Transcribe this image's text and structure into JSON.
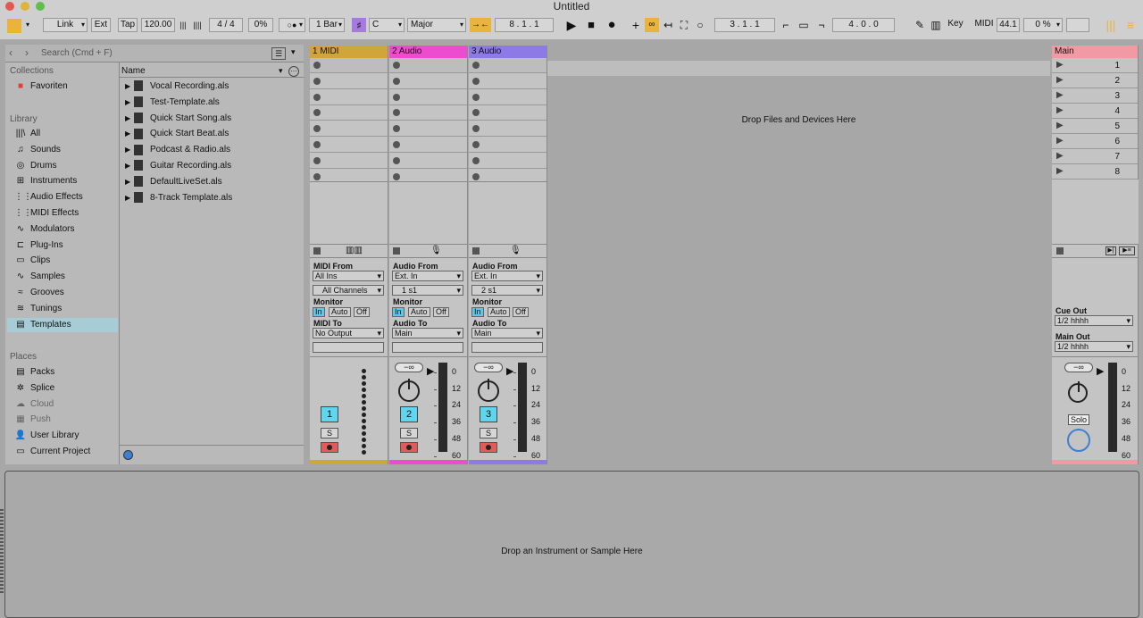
{
  "window": {
    "title": "Untitled"
  },
  "control_bar": {
    "link": "Link",
    "ext": "Ext",
    "tap": "Tap",
    "tempo": "120.00",
    "signature": "4 / 4",
    "cpu": "0%",
    "quantize": "1 Bar",
    "key": "C",
    "scale": "Major",
    "position": "8 . 1 . 1",
    "loop_start": "3 . 1 . 1",
    "loop_length": "4 . 0 . 0",
    "key_label": "Key",
    "midi_label": "MIDI",
    "sample_rate": "44.1",
    "cpu_load": "0 %"
  },
  "browser": {
    "search_placeholder": "Search (Cmd + F)",
    "collections_heading": "Collections",
    "favorites": "Favoriten",
    "library_heading": "Library",
    "library_items": [
      "All",
      "Sounds",
      "Drums",
      "Instruments",
      "Audio Effects",
      "MIDI Effects",
      "Modulators",
      "Plug-Ins",
      "Clips",
      "Samples",
      "Grooves",
      "Tunings",
      "Templates"
    ],
    "places_heading": "Places",
    "places_items": [
      "Packs",
      "Splice",
      "Cloud",
      "Push",
      "User Library",
      "Current Project"
    ],
    "column_name": "Name",
    "files": [
      "Vocal Recording.als",
      "Test-Template.als",
      "Quick Start Song.als",
      "Quick Start Beat.als",
      "Podcast & Radio.als",
      "Guitar Recording.als",
      "DefaultLiveSet.als",
      "8-Track Template.als"
    ]
  },
  "tracks": [
    {
      "name": "1 MIDI",
      "color": "#d2a53a",
      "from_label": "MIDI From",
      "from": "All Ins",
      "from2": "All Channels",
      "monitor": "Monitor",
      "mon_in": "In",
      "mon_auto": "Auto",
      "mon_off": "Off",
      "to_label": "MIDI To",
      "to": "No Output",
      "number": "1",
      "solo": "S"
    },
    {
      "name": "2 Audio",
      "color": "#ee4ccf",
      "from_label": "Audio From",
      "from": "Ext. In",
      "from2": "1 s1",
      "monitor": "Monitor",
      "mon_in": "In",
      "mon_auto": "Auto",
      "mon_off": "Off",
      "to_label": "Audio To",
      "to": "Main",
      "number": "2",
      "solo": "S",
      "volume": "−∞"
    },
    {
      "name": "3 Audio",
      "color": "#8d7ae6",
      "from_label": "Audio From",
      "from": "Ext. In",
      "from2": "2 s1",
      "monitor": "Monitor",
      "mon_in": "In",
      "mon_auto": "Auto",
      "mon_off": "Off",
      "to_label": "Audio To",
      "to": "Main",
      "number": "3",
      "solo": "S",
      "volume": "−∞"
    }
  ],
  "meter_scale": [
    "0",
    "12",
    "24",
    "36",
    "48",
    "60"
  ],
  "drop_files": "Drop Files and Devices Here",
  "main": {
    "name": "Main",
    "color": "#f29aa3",
    "scenes": [
      "1",
      "2",
      "3",
      "4",
      "5",
      "6",
      "7",
      "8"
    ],
    "cue_out_label": "Cue Out",
    "cue_out": "1/2 hhhh",
    "main_out_label": "Main Out",
    "main_out": "1/2 hhhh",
    "volume": "−∞",
    "solo": "Solo"
  },
  "device_view": {
    "drop_text": "Drop an Instrument or Sample Here"
  }
}
